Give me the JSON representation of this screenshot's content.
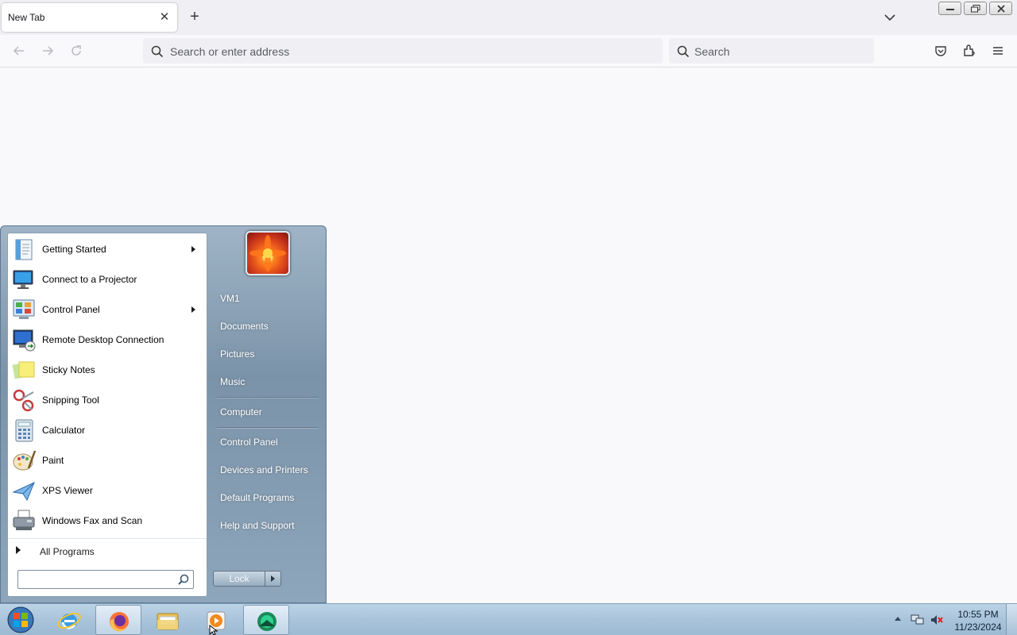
{
  "browser": {
    "tab_title": "New Tab",
    "url_placeholder": "Search or enter address",
    "search_placeholder": "Search"
  },
  "start_menu": {
    "programs": [
      {
        "label": "Getting Started",
        "icon": "getting-started-icon",
        "has_submenu": true
      },
      {
        "label": "Connect to a Projector",
        "icon": "projector-icon",
        "has_submenu": false
      },
      {
        "label": "Control Panel",
        "icon": "control-panel-icon",
        "has_submenu": true
      },
      {
        "label": "Remote Desktop Connection",
        "icon": "remote-desktop-icon",
        "has_submenu": false
      },
      {
        "label": "Sticky Notes",
        "icon": "sticky-notes-icon",
        "has_submenu": false
      },
      {
        "label": "Snipping Tool",
        "icon": "snipping-tool-icon",
        "has_submenu": false
      },
      {
        "label": "Calculator",
        "icon": "calculator-icon",
        "has_submenu": false
      },
      {
        "label": "Paint",
        "icon": "paint-icon",
        "has_submenu": false
      },
      {
        "label": "XPS Viewer",
        "icon": "xps-viewer-icon",
        "has_submenu": false
      },
      {
        "label": "Windows Fax and Scan",
        "icon": "fax-scan-icon",
        "has_submenu": false
      }
    ],
    "all_programs": "All Programs",
    "search_value": "",
    "right_items": {
      "user": "VM1",
      "documents": "Documents",
      "pictures": "Pictures",
      "music": "Music",
      "computer": "Computer",
      "control_panel": "Control Panel",
      "devices_printers": "Devices and Printers",
      "default_programs": "Default Programs",
      "help_support": "Help and Support"
    },
    "lock_label": "Lock"
  },
  "taskbar": {
    "apps": [
      "internet-explorer-icon",
      "firefox-icon",
      "file-explorer-icon",
      "media-player-icon",
      "app-icon"
    ],
    "active_apps": [
      "firefox-icon",
      "app-icon"
    ],
    "time": "10:55 PM",
    "date": "11/23/2024"
  }
}
